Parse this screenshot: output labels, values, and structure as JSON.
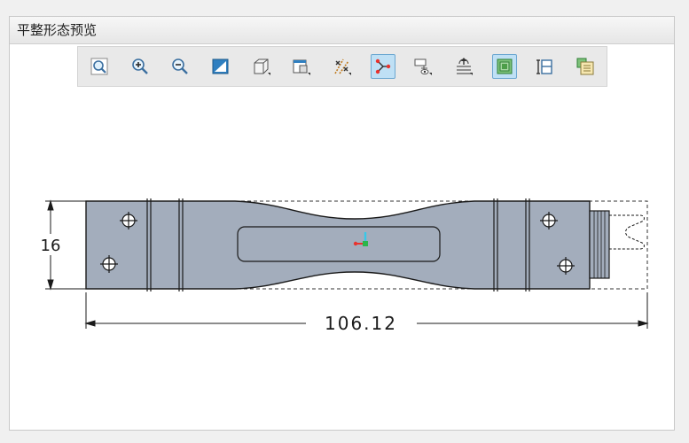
{
  "panel": {
    "title": "平整形态预览"
  },
  "toolbar": {
    "buttons": [
      {
        "icon": "zoom-fit-icon",
        "active": false
      },
      {
        "icon": "zoom-in-icon",
        "active": false
      },
      {
        "icon": "zoom-out-icon",
        "active": false
      },
      {
        "icon": "repaint-icon",
        "active": false
      },
      {
        "icon": "display-style-icon",
        "active": false
      },
      {
        "icon": "saved-views-icon",
        "active": false
      },
      {
        "icon": "datum-display-icon",
        "active": false
      },
      {
        "icon": "spin-center-icon",
        "active": true
      },
      {
        "icon": "view-manager-icon",
        "active": false
      },
      {
        "icon": "annotation-display-icon",
        "active": false
      },
      {
        "icon": "hidden-line-icon",
        "active": true
      },
      {
        "icon": "dimension-display-icon",
        "active": false
      },
      {
        "icon": "flat-pattern-icon",
        "active": false
      }
    ]
  },
  "drawing": {
    "dimension_height": "16",
    "dimension_length": "106.12",
    "part_color": "#a3adbc",
    "axis_colors": {
      "x": "#e8332e",
      "y": "#2bb64a",
      "z": "#38c8e8"
    }
  }
}
